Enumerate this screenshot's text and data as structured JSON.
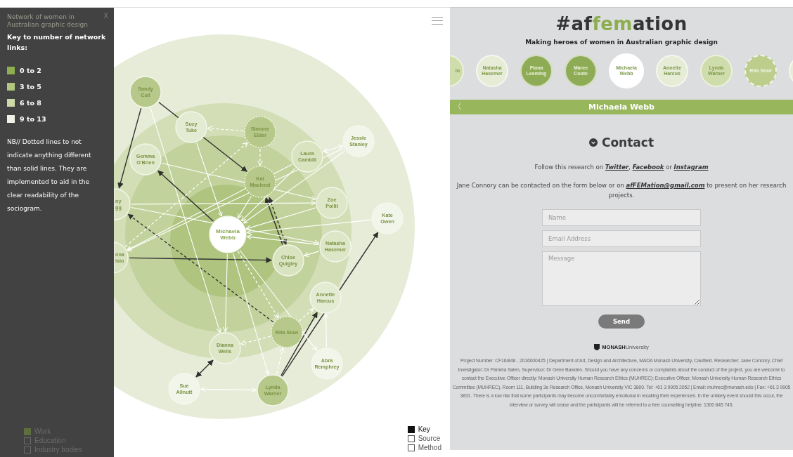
{
  "sociogram": {
    "nodes": [
      {
        "label": [
          "Sandy",
          "Cull"
        ],
        "color": "#b6c98a",
        "dashed": false
      },
      {
        "label": [
          "Suzy",
          "Tuke"
        ],
        "color": "#e4ebd3",
        "dashed": false
      },
      {
        "label": [
          "Simone",
          "Elder"
        ],
        "color": "#b6c98a",
        "dashed": true
      },
      {
        "label": [
          "Jessie",
          "Stanley"
        ],
        "color": "#f2f5ea",
        "dashed": false
      },
      {
        "label": [
          "Gemma",
          "O'Brien"
        ],
        "color": "#e0e8cb",
        "dashed": false
      },
      {
        "label": [
          "Laura",
          "Cambill"
        ],
        "color": "#d9e3c0",
        "dashed": false
      },
      {
        "label": [
          "Kat",
          "Macleod"
        ],
        "color": "#b6c98a",
        "dashed": true
      },
      {
        "label": [
          "Zoe",
          "Pollit"
        ],
        "color": "#dde6c6",
        "dashed": false
      },
      {
        "label": [
          "Kate",
          "Owen"
        ],
        "color": "#f2f5ea",
        "dashed": false
      },
      {
        "label": [
          "Michaela",
          "Webb"
        ],
        "color": "#ffffff",
        "dashed": false
      },
      {
        "label": [
          "Chloe",
          "Quigley"
        ],
        "color": "#d9e3c0",
        "dashed": false
      },
      {
        "label": [
          "Natasha",
          "Hasemer"
        ],
        "color": "#dde6c6",
        "dashed": false
      },
      {
        "label": [
          "Annette",
          "Harcus"
        ],
        "color": "#e4ebd3",
        "dashed": false
      },
      {
        "label": [
          "Rita Siow"
        ],
        "color": "#b6c98a",
        "dashed": true
      },
      {
        "label": [
          "Dianna",
          "Wells"
        ],
        "color": "#dde6c6",
        "dashed": false
      },
      {
        "label": [
          "Abra",
          "Remphrey"
        ],
        "color": "#f2f5ea",
        "dashed": false
      },
      {
        "label": [
          "Sue",
          "Allnutt"
        ],
        "color": "#f2f5ea",
        "dashed": false
      },
      {
        "label": [
          "Lynda",
          "Warner"
        ],
        "color": "#b6c98a",
        "dashed": false
      },
      {
        "label": [
          "ny",
          "gg"
        ],
        "color": "#d9e3c0",
        "dashed": false
      },
      {
        "label": [
          "nna",
          "isio"
        ],
        "color": "#d9e3c0",
        "dashed": false
      }
    ]
  },
  "view_filter": [
    {
      "label": "Key",
      "checked": true
    },
    {
      "label": "Source",
      "checked": false
    },
    {
      "label": "Method",
      "checked": false
    }
  ],
  "key_panel": {
    "title": "Network of women in Australian graphic design",
    "close": "X",
    "heading": "Key to number of network links:",
    "legend": [
      {
        "label": "0 to 2",
        "color": "#8fae4f"
      },
      {
        "label": "3 to 5",
        "color": "#b2c680"
      },
      {
        "label": "6 to 8",
        "color": "#cdd9a9"
      },
      {
        "label": "9 to 13",
        "color": "#eef1e4"
      }
    ],
    "note": "NB// Dotted lines to not indicate anything different than solid lines. They are implemented to aid in the clear readability of the sociogram.",
    "filters": [
      {
        "label": "Work",
        "checked": true
      },
      {
        "label": "Education",
        "checked": false
      },
      {
        "label": "Industry bodies",
        "checked": false
      }
    ]
  },
  "site": {
    "title": [
      {
        "text": "#af",
        "highlight": false
      },
      {
        "text": "fem",
        "highlight": true
      },
      {
        "text": "ation",
        "highlight": false
      }
    ],
    "tagline": "Making heroes of women in Australian graphic design",
    "people": [
      {
        "label": [
          "in"
        ],
        "color": "#cfdcab",
        "dashed": false,
        "selected": false
      },
      {
        "label": [
          "Natasha",
          "Hasemer"
        ],
        "color": "#e6ecd6",
        "dashed": false,
        "selected": false
      },
      {
        "label": [
          "Fiona",
          "Leeming"
        ],
        "color": "#8eab55",
        "dashed": false,
        "selected": false
      },
      {
        "label": [
          "Maree",
          "Coote"
        ],
        "color": "#8eab55",
        "dashed": false,
        "selected": false
      },
      {
        "label": [
          "Michaela",
          "Webb"
        ],
        "color": "#ffffff",
        "dashed": false,
        "selected": true
      },
      {
        "label": [
          "Annette",
          "Harcus"
        ],
        "color": "#e6ecd6",
        "dashed": false,
        "selected": false
      },
      {
        "label": [
          "Lynda",
          "Warner"
        ],
        "color": "#cfdcab",
        "dashed": false,
        "selected": false
      },
      {
        "label": [
          "Rita Siow"
        ],
        "color": "#bccd8c",
        "dashed": true,
        "selected": false
      },
      {
        "color": "#e6ecd6",
        "dashed": false,
        "selected": false
      }
    ],
    "profile_bar": {
      "back": "〈",
      "name": "Michaela Webb"
    },
    "contact": {
      "heading": "Contact",
      "follow": [
        {
          "kind": "text",
          "text": "Follow this research on "
        },
        {
          "kind": "link",
          "text": "Twitter"
        },
        {
          "kind": "text",
          "text": ", "
        },
        {
          "kind": "link",
          "text": "Facebook"
        },
        {
          "kind": "text",
          "text": " or "
        },
        {
          "kind": "link",
          "text": "Instagram"
        }
      ],
      "info": [
        {
          "kind": "text",
          "text": "Jane Connory can be contacted on the form below or on "
        },
        {
          "kind": "link",
          "text": "afFEMation@gmail.com"
        },
        {
          "kind": "text",
          "text": " to present on her research projects."
        }
      ],
      "fields": [
        {
          "kind": "input",
          "placeholder": "Name"
        },
        {
          "kind": "input",
          "placeholder": "Email Address"
        },
        {
          "kind": "textarea",
          "placeholder": "Message"
        }
      ],
      "send": "Send"
    },
    "logo": {
      "name": "MONASH",
      "suffix": "University"
    },
    "footer": "Project Number: CF16/848 - 2016000425 | Department of Art, Design and Architecture, MADA Monash University, Caulfield. Researcher: Jane Connory, Chief Investigator: Dr Pamela Salen, Supervisor: Dr Gene Bawden. Should you have any concerns or complaints about the conduct of the project, you are welcome to contact the Executive Officer directly: Monash University Human Research Ethics (MUHREC): Executive Officer, Monash University Human Research Ethics Committee (MUHREC), Room 111, Building 3e Research Office, Monash University VIC 3800. Tel: +61 3 9905 2052 | Email: muhrec@monash.edu | Fax: +61 3 9905 3831. There is a low risk that some participants may become uncomfortably emotional in recalling their experiences. In the unlikely event should this occur, the interview or survey will cease and the participants will be referred to a free counselling helpline: 1300 845 745."
  }
}
